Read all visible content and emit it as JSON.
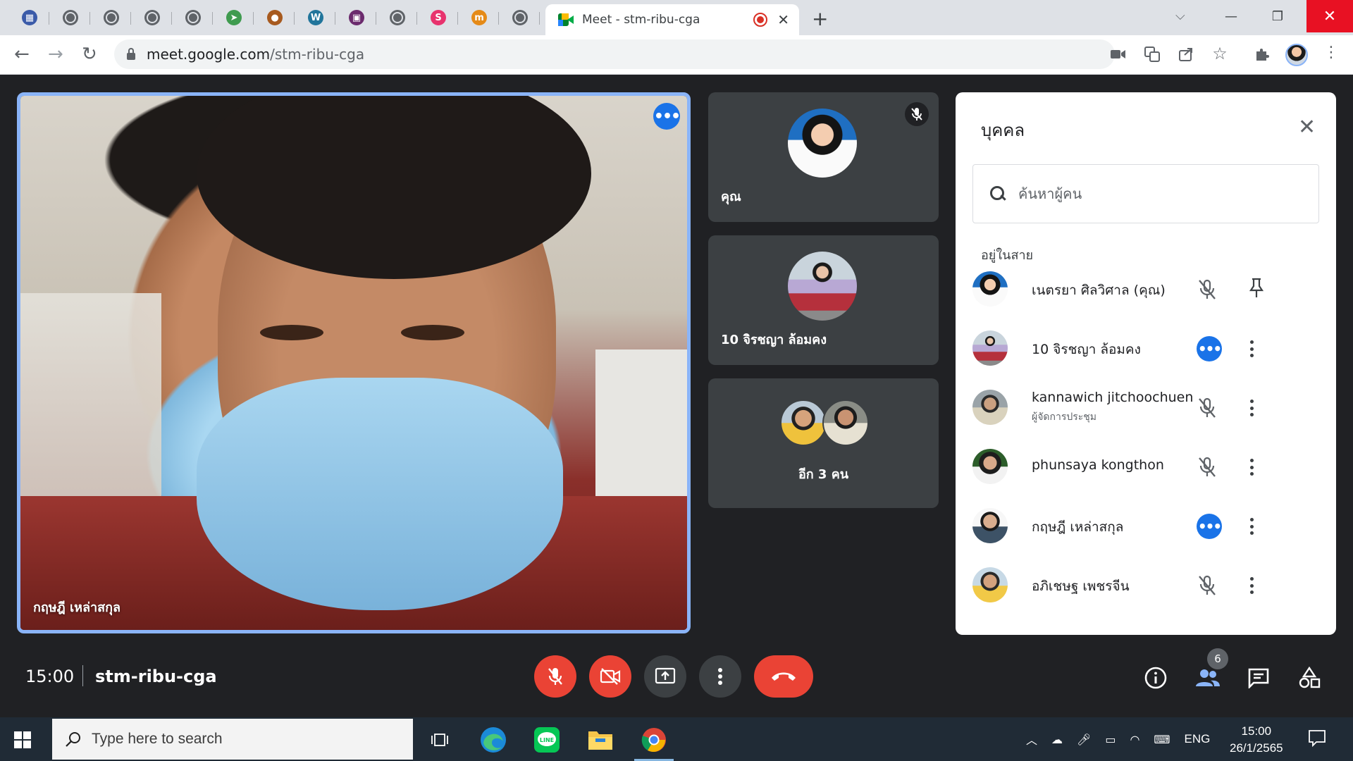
{
  "browser": {
    "active_tab_title": "Meet - stm-ribu-cga",
    "url_host": "meet.google.com",
    "url_path": "/stm-ribu-cga",
    "mini_tabs": [
      {
        "icon": "calendar-icon",
        "color": "#3b5ba9",
        "glyph": "▦"
      },
      {
        "icon": "globe-icon",
        "color": "#5f6368",
        "glyph": ""
      },
      {
        "icon": "globe-icon",
        "color": "#5f6368",
        "glyph": ""
      },
      {
        "icon": "globe-icon",
        "color": "#5f6368",
        "glyph": ""
      },
      {
        "icon": "globe-icon",
        "color": "#5f6368",
        "glyph": ""
      },
      {
        "icon": "plane-icon",
        "color": "#3f9b4f",
        "glyph": "➤"
      },
      {
        "icon": "crest-icon",
        "color": "#a75a1f",
        "glyph": "●"
      },
      {
        "icon": "wordpress-icon",
        "color": "#21759b",
        "glyph": "W"
      },
      {
        "icon": "school-icon",
        "color": "#6b2a6d",
        "glyph": "▣"
      },
      {
        "icon": "globe-icon",
        "color": "#5f6368",
        "glyph": ""
      },
      {
        "icon": "s-logo-icon",
        "color": "#e8336e",
        "glyph": "S"
      },
      {
        "icon": "m-logo-icon",
        "color": "#e58a17",
        "glyph": "m"
      },
      {
        "icon": "globe-icon",
        "color": "#5f6368",
        "glyph": ""
      }
    ]
  },
  "meeting": {
    "main_speaker_name": "กฤษฎี เหล่าสกุล",
    "time": "15:00",
    "code": "stm-ribu-cga",
    "tiles": [
      {
        "name": "คุณ"
      },
      {
        "name": "10 จิรชญา ล้อมคง"
      },
      {
        "name": "อีก 3 คน"
      }
    ],
    "participant_count": "6"
  },
  "people_panel": {
    "title": "บุคคล",
    "search_placeholder": "ค้นหาผู้คน",
    "section_label": "อยู่ในสาย",
    "participants": [
      {
        "name": "เนตรยา ศิลวิศาล (คุณ)",
        "subtitle": "",
        "status": "muted",
        "action": "pin"
      },
      {
        "name": "10 จิรชญา ล้อมคง",
        "subtitle": "",
        "status": "speaking",
        "action": "more"
      },
      {
        "name": "kannawich jitchoochuen",
        "subtitle": "ผู้จัดการประชุม",
        "status": "muted",
        "action": "more"
      },
      {
        "name": "phunsaya kongthon",
        "subtitle": "",
        "status": "muted",
        "action": "more"
      },
      {
        "name": "กฤษฎี เหล่าสกุล",
        "subtitle": "",
        "status": "speaking",
        "action": "more"
      },
      {
        "name": "อภิเชษฐ เพชรจีน",
        "subtitle": "",
        "status": "muted",
        "action": "more"
      }
    ]
  },
  "taskbar": {
    "search_placeholder": "Type here to search",
    "language": "ENG",
    "time": "15:00",
    "date": "26/1/2565"
  },
  "colors": {
    "meet_bg": "#202124",
    "tile_bg": "#3c4043",
    "accent_blue": "#1a73e8",
    "active_border": "#8ab4f8",
    "danger_red": "#ea4335"
  }
}
